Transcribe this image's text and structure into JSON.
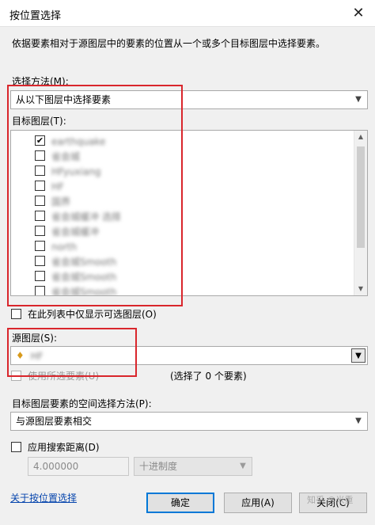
{
  "window": {
    "title": "按位置选择",
    "close_symbol": "✕"
  },
  "description": "依据要素相对于源图层中的要素的位置从一个或多个目标图层中选择要素。",
  "selection_method": {
    "label": "选择方法(M):",
    "value": "从以下图层中选择要素"
  },
  "target_layers": {
    "label": "目标图层(T):",
    "items": [
      {
        "label": "earthquake",
        "checked": true
      },
      {
        "label": "省会城",
        "checked": false
      },
      {
        "label": "HFyuxiang",
        "checked": false
      },
      {
        "label": "HF",
        "checked": false
      },
      {
        "label": "国界",
        "checked": false
      },
      {
        "label": "省会城缓冲 选择",
        "checked": false
      },
      {
        "label": "省会城缓冲",
        "checked": false
      },
      {
        "label": "north",
        "checked": false
      },
      {
        "label": "省会城Smooth",
        "checked": false
      },
      {
        "label": "省会城Smooth",
        "checked": false
      },
      {
        "label": "省会城Smooth",
        "checked": false
      }
    ]
  },
  "only_selectable": {
    "label": "在此列表中仅显示可选图层(O)",
    "checked": false
  },
  "source_layer": {
    "label": "源图层(S):",
    "value": "HF",
    "icon": "layer-icon"
  },
  "use_selected": {
    "label": "使用所选要素(U)",
    "checked": false,
    "status": "(选择了 0 个要素)"
  },
  "spatial_method": {
    "label": "目标图层要素的空间选择方法(P):",
    "value": "与源图层要素相交"
  },
  "search_distance": {
    "label": "应用搜索距离(D)",
    "checked": false,
    "value": "4.000000",
    "unit": "十进制度"
  },
  "footer": {
    "help_link": "关于按位置选择",
    "ok": "确定",
    "apply": "应用(A)",
    "close": "关闭(C)",
    "watermark": "知乎 @米重"
  },
  "colors": {
    "highlight": "#d9262c",
    "link": "#0645ad",
    "primary_border": "#0078d7"
  }
}
